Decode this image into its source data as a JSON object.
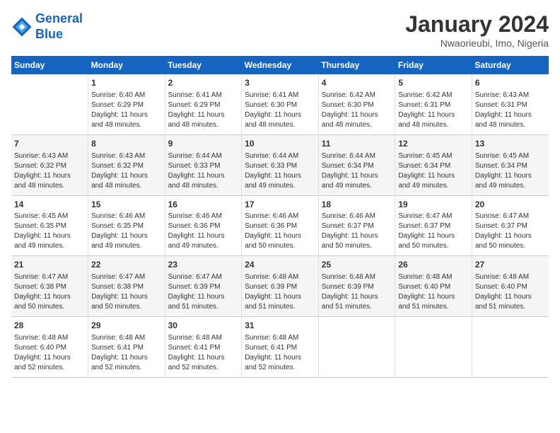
{
  "header": {
    "logo_line1": "General",
    "logo_line2": "Blue",
    "month_title": "January 2024",
    "location": "Nwaorieubi, Imo, Nigeria"
  },
  "days_of_week": [
    "Sunday",
    "Monday",
    "Tuesday",
    "Wednesday",
    "Thursday",
    "Friday",
    "Saturday"
  ],
  "weeks": [
    [
      {
        "num": "",
        "detail": ""
      },
      {
        "num": "1",
        "detail": "Sunrise: 6:40 AM\nSunset: 6:29 PM\nDaylight: 11 hours\nand 48 minutes."
      },
      {
        "num": "2",
        "detail": "Sunrise: 6:41 AM\nSunset: 6:29 PM\nDaylight: 11 hours\nand 48 minutes."
      },
      {
        "num": "3",
        "detail": "Sunrise: 6:41 AM\nSunset: 6:30 PM\nDaylight: 11 hours\nand 48 minutes."
      },
      {
        "num": "4",
        "detail": "Sunrise: 6:42 AM\nSunset: 6:30 PM\nDaylight: 11 hours\nand 48 minutes."
      },
      {
        "num": "5",
        "detail": "Sunrise: 6:42 AM\nSunset: 6:31 PM\nDaylight: 11 hours\nand 48 minutes."
      },
      {
        "num": "6",
        "detail": "Sunrise: 6:43 AM\nSunset: 6:31 PM\nDaylight: 11 hours\nand 48 minutes."
      }
    ],
    [
      {
        "num": "7",
        "detail": "Sunrise: 6:43 AM\nSunset: 6:32 PM\nDaylight: 11 hours\nand 48 minutes."
      },
      {
        "num": "8",
        "detail": "Sunrise: 6:43 AM\nSunset: 6:32 PM\nDaylight: 11 hours\nand 48 minutes."
      },
      {
        "num": "9",
        "detail": "Sunrise: 6:44 AM\nSunset: 6:33 PM\nDaylight: 11 hours\nand 48 minutes."
      },
      {
        "num": "10",
        "detail": "Sunrise: 6:44 AM\nSunset: 6:33 PM\nDaylight: 11 hours\nand 49 minutes."
      },
      {
        "num": "11",
        "detail": "Sunrise: 6:44 AM\nSunset: 6:34 PM\nDaylight: 11 hours\nand 49 minutes."
      },
      {
        "num": "12",
        "detail": "Sunrise: 6:45 AM\nSunset: 6:34 PM\nDaylight: 11 hours\nand 49 minutes."
      },
      {
        "num": "13",
        "detail": "Sunrise: 6:45 AM\nSunset: 6:34 PM\nDaylight: 11 hours\nand 49 minutes."
      }
    ],
    [
      {
        "num": "14",
        "detail": "Sunrise: 6:45 AM\nSunset: 6:35 PM\nDaylight: 11 hours\nand 49 minutes."
      },
      {
        "num": "15",
        "detail": "Sunrise: 6:46 AM\nSunset: 6:35 PM\nDaylight: 11 hours\nand 49 minutes."
      },
      {
        "num": "16",
        "detail": "Sunrise: 6:46 AM\nSunset: 6:36 PM\nDaylight: 11 hours\nand 49 minutes."
      },
      {
        "num": "17",
        "detail": "Sunrise: 6:46 AM\nSunset: 6:36 PM\nDaylight: 11 hours\nand 50 minutes."
      },
      {
        "num": "18",
        "detail": "Sunrise: 6:46 AM\nSunset: 6:37 PM\nDaylight: 11 hours\nand 50 minutes."
      },
      {
        "num": "19",
        "detail": "Sunrise: 6:47 AM\nSunset: 6:37 PM\nDaylight: 11 hours\nand 50 minutes."
      },
      {
        "num": "20",
        "detail": "Sunrise: 6:47 AM\nSunset: 6:37 PM\nDaylight: 11 hours\nand 50 minutes."
      }
    ],
    [
      {
        "num": "21",
        "detail": "Sunrise: 6:47 AM\nSunset: 6:38 PM\nDaylight: 11 hours\nand 50 minutes."
      },
      {
        "num": "22",
        "detail": "Sunrise: 6:47 AM\nSunset: 6:38 PM\nDaylight: 11 hours\nand 50 minutes."
      },
      {
        "num": "23",
        "detail": "Sunrise: 6:47 AM\nSunset: 6:39 PM\nDaylight: 11 hours\nand 51 minutes."
      },
      {
        "num": "24",
        "detail": "Sunrise: 6:48 AM\nSunset: 6:39 PM\nDaylight: 11 hours\nand 51 minutes."
      },
      {
        "num": "25",
        "detail": "Sunrise: 6:48 AM\nSunset: 6:39 PM\nDaylight: 11 hours\nand 51 minutes."
      },
      {
        "num": "26",
        "detail": "Sunrise: 6:48 AM\nSunset: 6:40 PM\nDaylight: 11 hours\nand 51 minutes."
      },
      {
        "num": "27",
        "detail": "Sunrise: 6:48 AM\nSunset: 6:40 PM\nDaylight: 11 hours\nand 51 minutes."
      }
    ],
    [
      {
        "num": "28",
        "detail": "Sunrise: 6:48 AM\nSunset: 6:40 PM\nDaylight: 11 hours\nand 52 minutes."
      },
      {
        "num": "29",
        "detail": "Sunrise: 6:48 AM\nSunset: 6:41 PM\nDaylight: 11 hours\nand 52 minutes."
      },
      {
        "num": "30",
        "detail": "Sunrise: 6:48 AM\nSunset: 6:41 PM\nDaylight: 11 hours\nand 52 minutes."
      },
      {
        "num": "31",
        "detail": "Sunrise: 6:48 AM\nSunset: 6:41 PM\nDaylight: 11 hours\nand 52 minutes."
      },
      {
        "num": "",
        "detail": ""
      },
      {
        "num": "",
        "detail": ""
      },
      {
        "num": "",
        "detail": ""
      }
    ]
  ]
}
